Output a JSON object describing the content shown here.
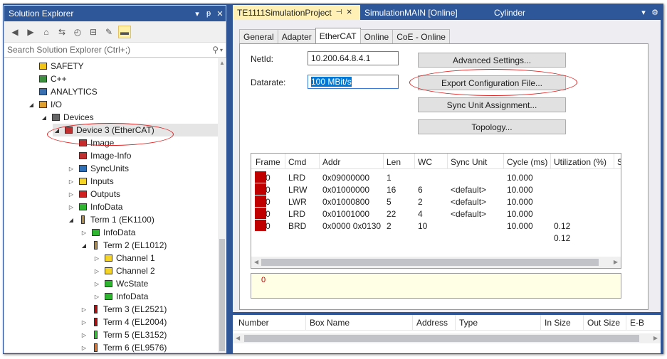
{
  "solution_explorer": {
    "title": "Solution Explorer",
    "title_controls": [
      "▾",
      "ᵽ",
      "✕"
    ],
    "search_placeholder": "Search Solution Explorer (Ctrl+;)",
    "tree": [
      {
        "label": "SAFETY",
        "exp": "",
        "icon": "safety-icon"
      },
      {
        "label": "C++",
        "exp": "",
        "icon": "cpp-icon"
      },
      {
        "label": "ANALYTICS",
        "exp": "",
        "icon": "analytics-icon"
      },
      {
        "label": "I/O",
        "exp": "◢",
        "icon": "io-icon"
      },
      {
        "label": "Devices",
        "exp": "◢",
        "icon": "devices-icon"
      },
      {
        "label": "Device 3 (EtherCAT)",
        "exp": "◢",
        "icon": "ethercat-device-icon"
      },
      {
        "label": "Image",
        "exp": "",
        "icon": "image-icon"
      },
      {
        "label": "Image-Info",
        "exp": "",
        "icon": "image-info-icon"
      },
      {
        "label": "SyncUnits",
        "exp": "▷",
        "icon": "syncunits-icon"
      },
      {
        "label": "Inputs",
        "exp": "▷",
        "icon": "inputs-icon"
      },
      {
        "label": "Outputs",
        "exp": "▷",
        "icon": "outputs-icon"
      },
      {
        "label": "InfoData",
        "exp": "▷",
        "icon": "infodata-icon"
      },
      {
        "label": "Term 1 (EK1100)",
        "exp": "◢",
        "icon": "coupler-icon"
      },
      {
        "label": "InfoData",
        "exp": "▷",
        "icon": "infodata-icon"
      },
      {
        "label": "Term 2 (EL1012)",
        "exp": "◢",
        "icon": "terminal-icon"
      },
      {
        "label": "Channel 1",
        "exp": "▷",
        "icon": "channel-icon"
      },
      {
        "label": "Channel 2",
        "exp": "▷",
        "icon": "channel-icon"
      },
      {
        "label": "WcState",
        "exp": "▷",
        "icon": "wcstate-icon"
      },
      {
        "label": "InfoData",
        "exp": "▷",
        "icon": "infodata-icon"
      },
      {
        "label": "Term 3 (EL2521)",
        "exp": "▷",
        "icon": "terminal-icon"
      },
      {
        "label": "Term 4 (EL2004)",
        "exp": "▷",
        "icon": "terminal-icon"
      },
      {
        "label": "Term 5 (EL3152)",
        "exp": "▷",
        "icon": "terminal-icon"
      },
      {
        "label": "Term 6 (EL9576)",
        "exp": "▷",
        "icon": "terminal-icon"
      }
    ]
  },
  "doc_tabs": [
    {
      "label": "TE1111SimulationProject",
      "active": true,
      "pin": "⊣",
      "close": "✕"
    },
    {
      "label": "SimulationMAIN [Online]",
      "active": false
    },
    {
      "label": "Cylinder",
      "active": false
    }
  ],
  "doc_tab_controls": [
    "▾",
    "⚙"
  ],
  "inner_tabs": [
    "General",
    "Adapter",
    "EtherCAT",
    "Online",
    "CoE - Online"
  ],
  "form": {
    "netid_label": "NetId:",
    "netid_value": "10.200.64.8.4.1",
    "datarate_label": "Datarate:",
    "datarate_value": "100 MBit/s",
    "buttons": [
      "Advanced Settings...",
      "Export Configuration File...",
      "Sync Unit Assignment...",
      "Topology..."
    ]
  },
  "frames_table": {
    "columns": [
      "Frame",
      "Cmd",
      "Addr",
      "Len",
      "WC",
      "Sync Unit",
      "Cycle (ms)",
      "Utilization (%)",
      "S"
    ],
    "rows": [
      {
        "frame": "0",
        "cmd": "LRD",
        "addr": "0x09000000",
        "len": "1",
        "wc": "",
        "sync": "",
        "cycle": "10.000",
        "util": ""
      },
      {
        "frame": "0",
        "cmd": "LRW",
        "addr": "0x01000000",
        "len": "16",
        "wc": "6",
        "sync": "<default>",
        "cycle": "10.000",
        "util": ""
      },
      {
        "frame": "0",
        "cmd": "LWR",
        "addr": "0x01000800",
        "len": "5",
        "wc": "2",
        "sync": "<default>",
        "cycle": "10.000",
        "util": ""
      },
      {
        "frame": "0",
        "cmd": "LRD",
        "addr": "0x01001000",
        "len": "22",
        "wc": "4",
        "sync": "<default>",
        "cycle": "10.000",
        "util": ""
      },
      {
        "frame": "0",
        "cmd": "BRD",
        "addr": "0x0000 0x0130",
        "len": "2",
        "wc": "10",
        "sync": "",
        "cycle": "10.000",
        "util": "0.12"
      },
      {
        "frame": "",
        "cmd": "",
        "addr": "",
        "len": "",
        "wc": "",
        "sync": "",
        "cycle": "",
        "util": "0.12"
      }
    ]
  },
  "log_value": "0",
  "bottom_list": {
    "columns": [
      "Number",
      "Box Name",
      "Address",
      "Type",
      "In Size",
      "Out Size",
      "E-B"
    ]
  },
  "colors": {
    "accent": "#2e579a",
    "active_tab": "#fff1b6",
    "annotation": "#e02020",
    "frame_marker": "#c00000"
  }
}
